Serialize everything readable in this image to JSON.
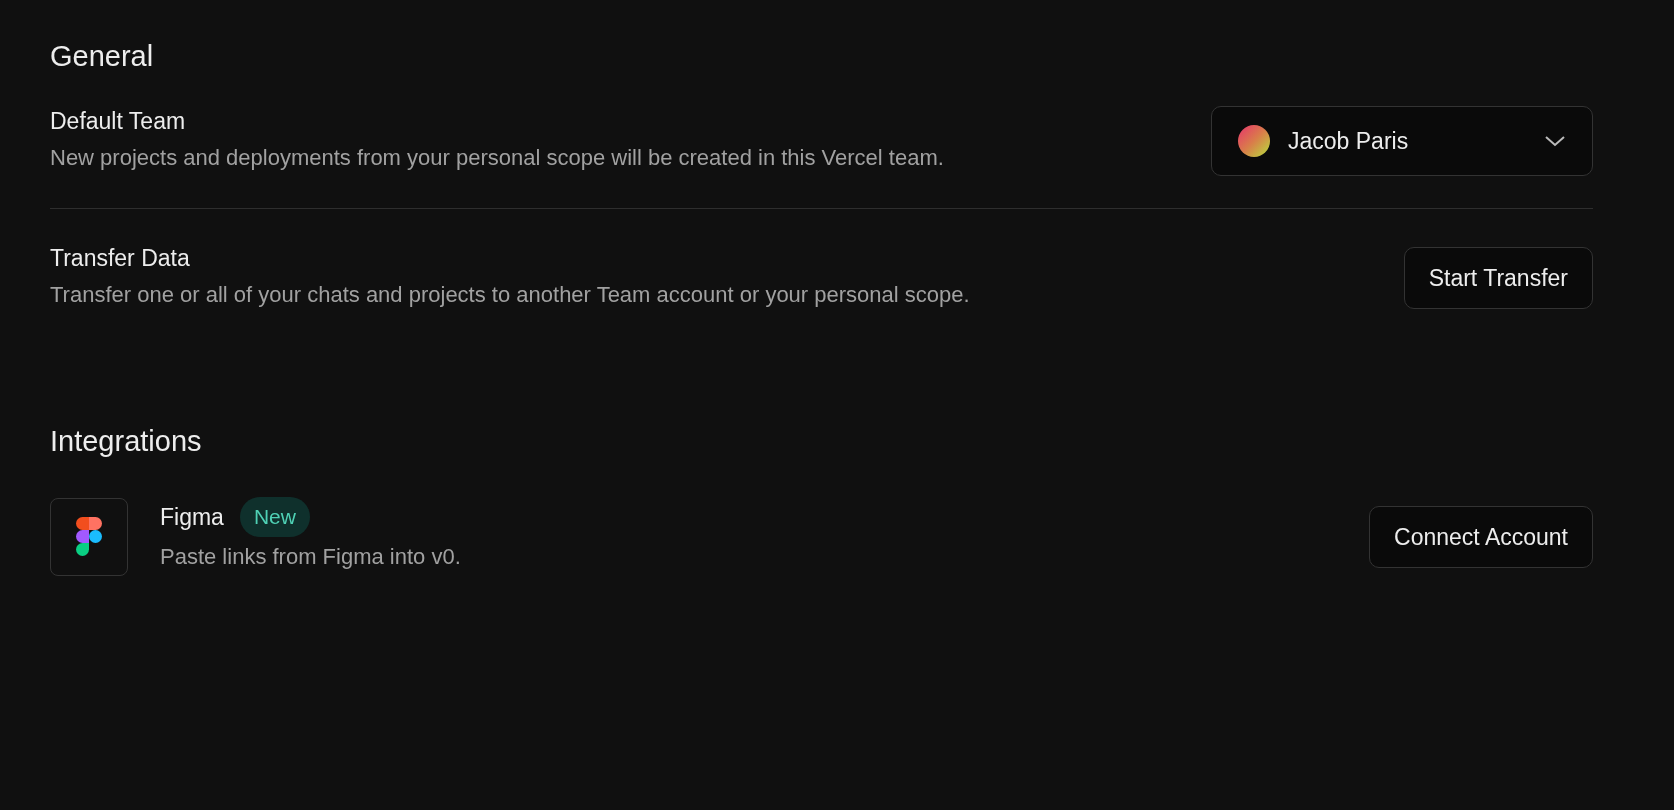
{
  "general": {
    "title": "General",
    "rows": [
      {
        "kind": "select",
        "title": "Default Team",
        "description": "New projects and deployments from your personal scope will be created in this Vercel team.",
        "value": "Jacob Paris"
      },
      {
        "kind": "button",
        "title": "Transfer Data",
        "description": "Transfer one or all of your chats and projects to another Team account or your personal scope.",
        "button": "Start Transfer"
      }
    ]
  },
  "integrations": {
    "title": "Integrations",
    "items": [
      {
        "name": "Figma",
        "badge": "New",
        "description": "Paste links from Figma into v0.",
        "button": "Connect Account"
      }
    ]
  }
}
